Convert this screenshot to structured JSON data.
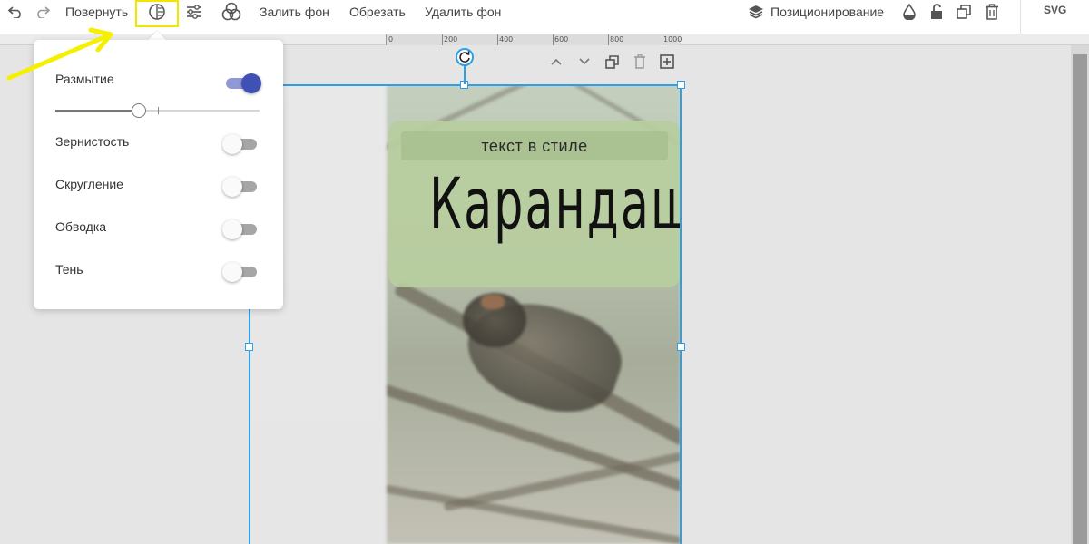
{
  "toolbar": {
    "undo_icon": "undo-icon",
    "redo_icon": "redo-icon",
    "rotate_label": "Повернуть",
    "blur_icon": "blur-effects-icon",
    "adjust_icon": "sliders-icon",
    "blend_icon": "blend-circles-icon",
    "fill_bg_label": "Залить фон",
    "crop_label": "Обрезать",
    "remove_bg_label": "Удалить фон",
    "positioning_label": "Позиционирование",
    "transparency_icon": "drop-icon",
    "lock_icon": "unlock-icon",
    "duplicate_icon": "duplicate-icon",
    "delete_icon": "trash-icon",
    "export_label": "SVG"
  },
  "ruler": {
    "labels": [
      "0",
      "200",
      "400",
      "600",
      "800",
      "1000"
    ]
  },
  "effects_panel": {
    "options": [
      {
        "label": "Размытие",
        "enabled": true
      },
      {
        "label": "Зернистость",
        "enabled": false
      },
      {
        "label": "Скругление",
        "enabled": false
      },
      {
        "label": "Обводка",
        "enabled": false
      },
      {
        "label": "Тень",
        "enabled": false
      }
    ],
    "blur_level": 0.41
  },
  "artwork": {
    "subtitle": "текст в стиле",
    "title": "Карандаш"
  },
  "colors": {
    "selection": "#2aa0e8",
    "toggle_on": "#3f51b5",
    "highlight_box": "#f2e600",
    "annotation_arrow": "#f5f000"
  }
}
